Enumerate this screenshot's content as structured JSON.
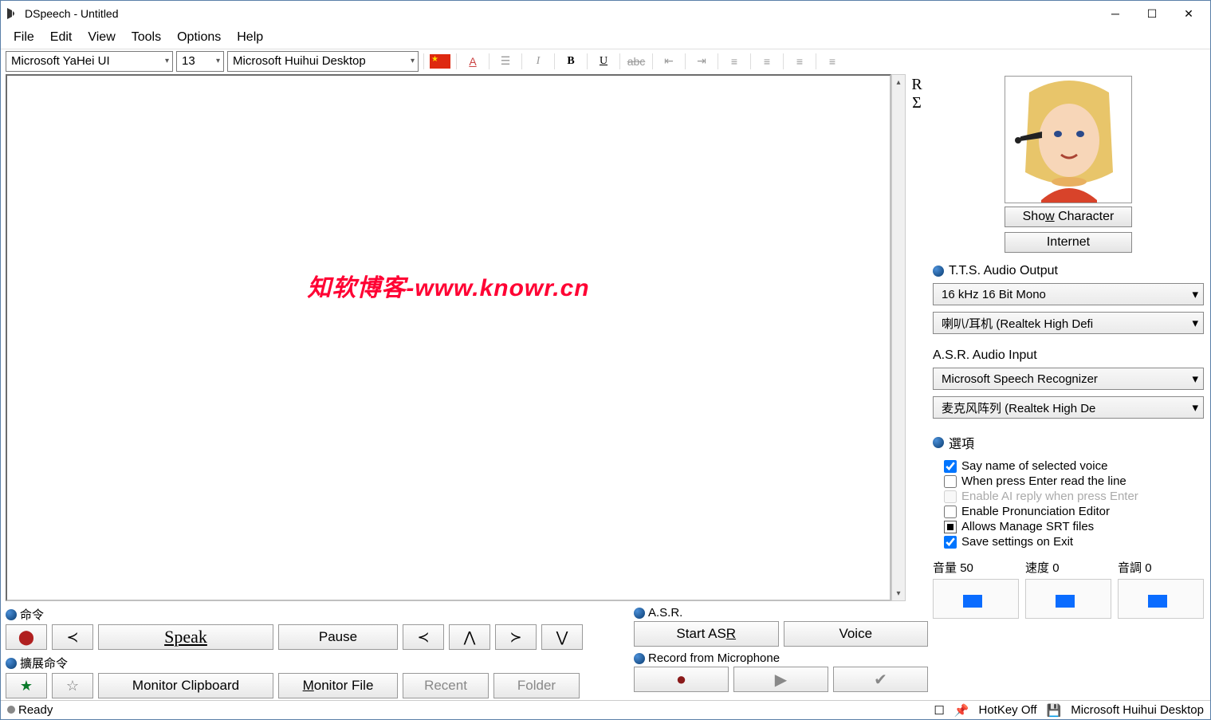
{
  "title": "DSpeech - Untitled",
  "menu": {
    "file": "File",
    "edit": "Edit",
    "view": "View",
    "tools": "Tools",
    "options": "Options",
    "help": "Help"
  },
  "toolbar": {
    "font": "Microsoft YaHei UI",
    "size": "13",
    "voice": "Microsoft Huihui Desktop"
  },
  "side_letters": {
    "r": "R",
    "sigma": "Σ"
  },
  "watermark": "知软博客-www.knowr.cn",
  "show_character": "Show Character",
  "internet": "Internet",
  "tts_hdr": "T.T.S. Audio Output",
  "tts_format": "16 kHz 16 Bit Mono",
  "tts_device": "喇叭/耳机 (Realtek High Defi",
  "asr_hdr": "A.S.R. Audio Input",
  "asr_engine": "Microsoft Speech Recognizer",
  "asr_device": "麦克风阵列 (Realtek High De",
  "opts_hdr": "選項",
  "opt1": "Say name of selected voice",
  "opt2": "When press Enter read the line",
  "opt3": "Enable AI reply when press Enter",
  "opt4": "Enable Pronunciation Editor",
  "opt5": "Allows Manage SRT files",
  "opt6": "Save settings on Exit",
  "cmd_hdr": "命令",
  "ext_cmd_hdr": "擴展命令",
  "speak": "Speak",
  "pause": "Pause",
  "monitor_clip": "Monitor Clipboard",
  "monitor_file": "Monitor File",
  "recent": "Recent",
  "folder": "Folder",
  "asr_grp": "A.S.R.",
  "start_asr": "Start ASR",
  "voice_btn": "Voice",
  "rec_hdr": "Record from Microphone",
  "vol_lbl": "音量",
  "vol_val": "50",
  "speed_lbl": "速度",
  "speed_val": "0",
  "pitch_lbl": "音調",
  "pitch_val": "0",
  "status_ready": "Ready",
  "status_hotkey": "HotKey Off",
  "status_voice": "Microsoft Huihui Desktop"
}
